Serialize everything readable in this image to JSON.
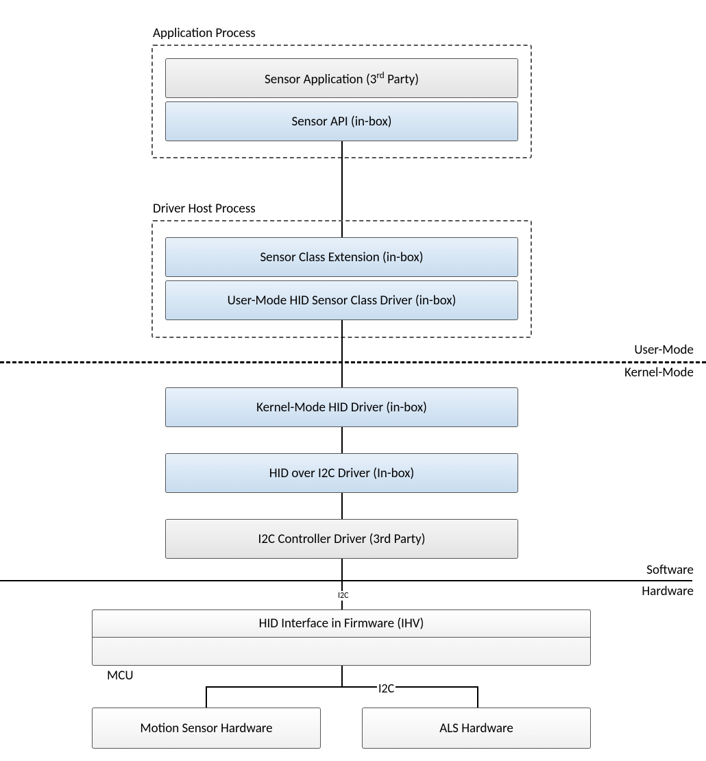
{
  "groups": {
    "app_process": "Application Process",
    "driver_host": "Driver Host Process"
  },
  "boxes": {
    "sensor_app_pre": "Sensor Application (3",
    "sensor_app_sup": "rd",
    "sensor_app_post": " Party)",
    "sensor_api": "Sensor API (in-box)",
    "sensor_class_ext": "Sensor Class Extension (in-box)",
    "user_mode_hid": "User-Mode HID Sensor Class Driver (in-box)",
    "kernel_hid": "Kernel-Mode HID Driver (in-box)",
    "hid_i2c": "HID over I2C Driver (In-box)",
    "i2c_ctrl": "I2C Controller Driver (3rd Party)",
    "hid_fw": "HID Interface in Firmware (IHV)",
    "mcu_label": "MCU",
    "motion_sensor": "Motion Sensor Hardware",
    "als_hw": "ALS Hardware"
  },
  "side_labels": {
    "user_mode": "User-Mode",
    "kernel_mode": "Kernel-Mode",
    "software": "Software",
    "hardware": "Hardware"
  },
  "conn_labels": {
    "i2c_top": "I2C",
    "i2c_bottom": "I2C"
  }
}
